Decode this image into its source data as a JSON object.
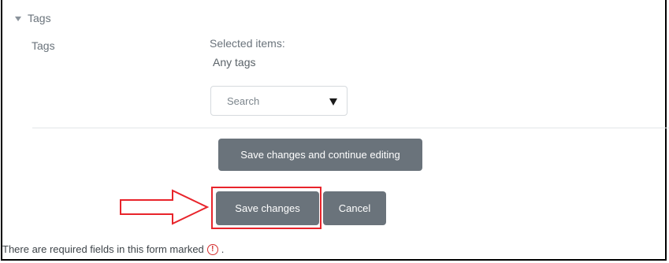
{
  "section": {
    "title": "Tags"
  },
  "tags_field": {
    "label": "Tags",
    "selected_label": "Selected items:",
    "selected_value": "Any tags",
    "search_placeholder": "Search"
  },
  "buttons": {
    "save_continue": "Save changes and continue editing",
    "save": "Save changes",
    "cancel": "Cancel"
  },
  "footer": {
    "required_note": "There are required fields in this form marked",
    "required_suffix": ".",
    "required_icon": "exclamation-circle-icon"
  },
  "annotation": {
    "highlight_color": "#e8242b"
  },
  "colors": {
    "button_bg": "#6a737b",
    "label": "#6a737b",
    "required": "#d42d2d"
  }
}
